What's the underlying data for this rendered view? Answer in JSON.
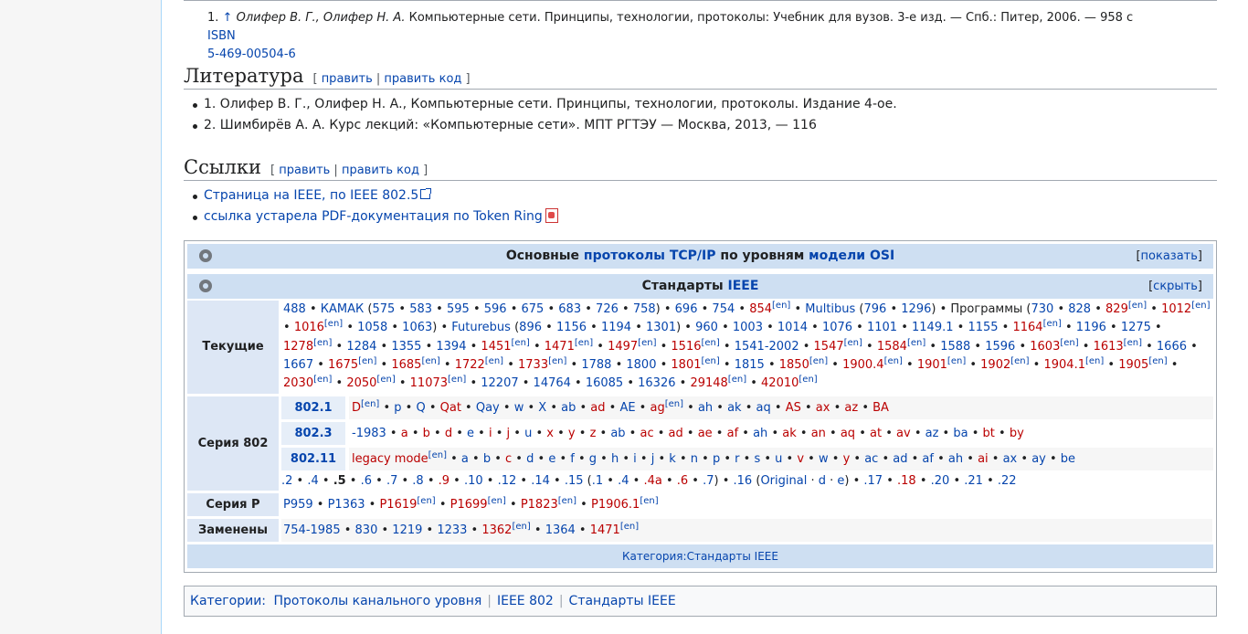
{
  "reference": {
    "arrow": "↑",
    "authors": "Олифер В. Г., Олифер Н. А.",
    "text": "Компьютерные сети. Принципы, технологии, протоколы: Учебник для вузов. 3-е изд. — Спб.: Питер, 2006. — 958 с",
    "isbn_label": "ISBN",
    "isbn": "5-469-00504-6",
    "number": "1."
  },
  "literature": {
    "title": "Литература",
    "edit": "править",
    "edit_code": "править код",
    "items": [
      "1. Олифер В. Г., Олифер Н. А., Компьютерные сети. Принципы, технологии, протоколы. Издание 4-ое.",
      "2. Шимбирёв А. А. Курс лекций: «Компьютерные сети». МПТ РГТЭУ — Москва, 2013, — 116"
    ]
  },
  "links": {
    "title": "Ссылки",
    "edit": "править",
    "edit_code": "править код",
    "items": [
      "Страница на IEEE, по IEEE 802.5",
      "ссылка устарела PDF-документация по Token Ring"
    ]
  },
  "navbox1": {
    "title_pre": "Основные ",
    "title_link1": "протоколы TCP/IP",
    "title_mid": " по уровням ",
    "title_link2": "модели OSI",
    "toggle": "показать"
  },
  "navbox2": {
    "title_pre": "Стандарты ",
    "title_link": "IEEE",
    "toggle": "скрыть",
    "group_current": "Текущие",
    "group_802": "Серия 802",
    "sub_8021": "802.1",
    "sub_8023": "802.3",
    "sub_80211": "802.11",
    "group_p": "Серия P",
    "group_replaced": "Заменены",
    "footer": "Категория:Стандарты IEEE"
  },
  "categories": {
    "label": "Категории:",
    "items": [
      "Протоколы канального уровня",
      "IEEE 802",
      "Стандарты IEEE"
    ]
  }
}
